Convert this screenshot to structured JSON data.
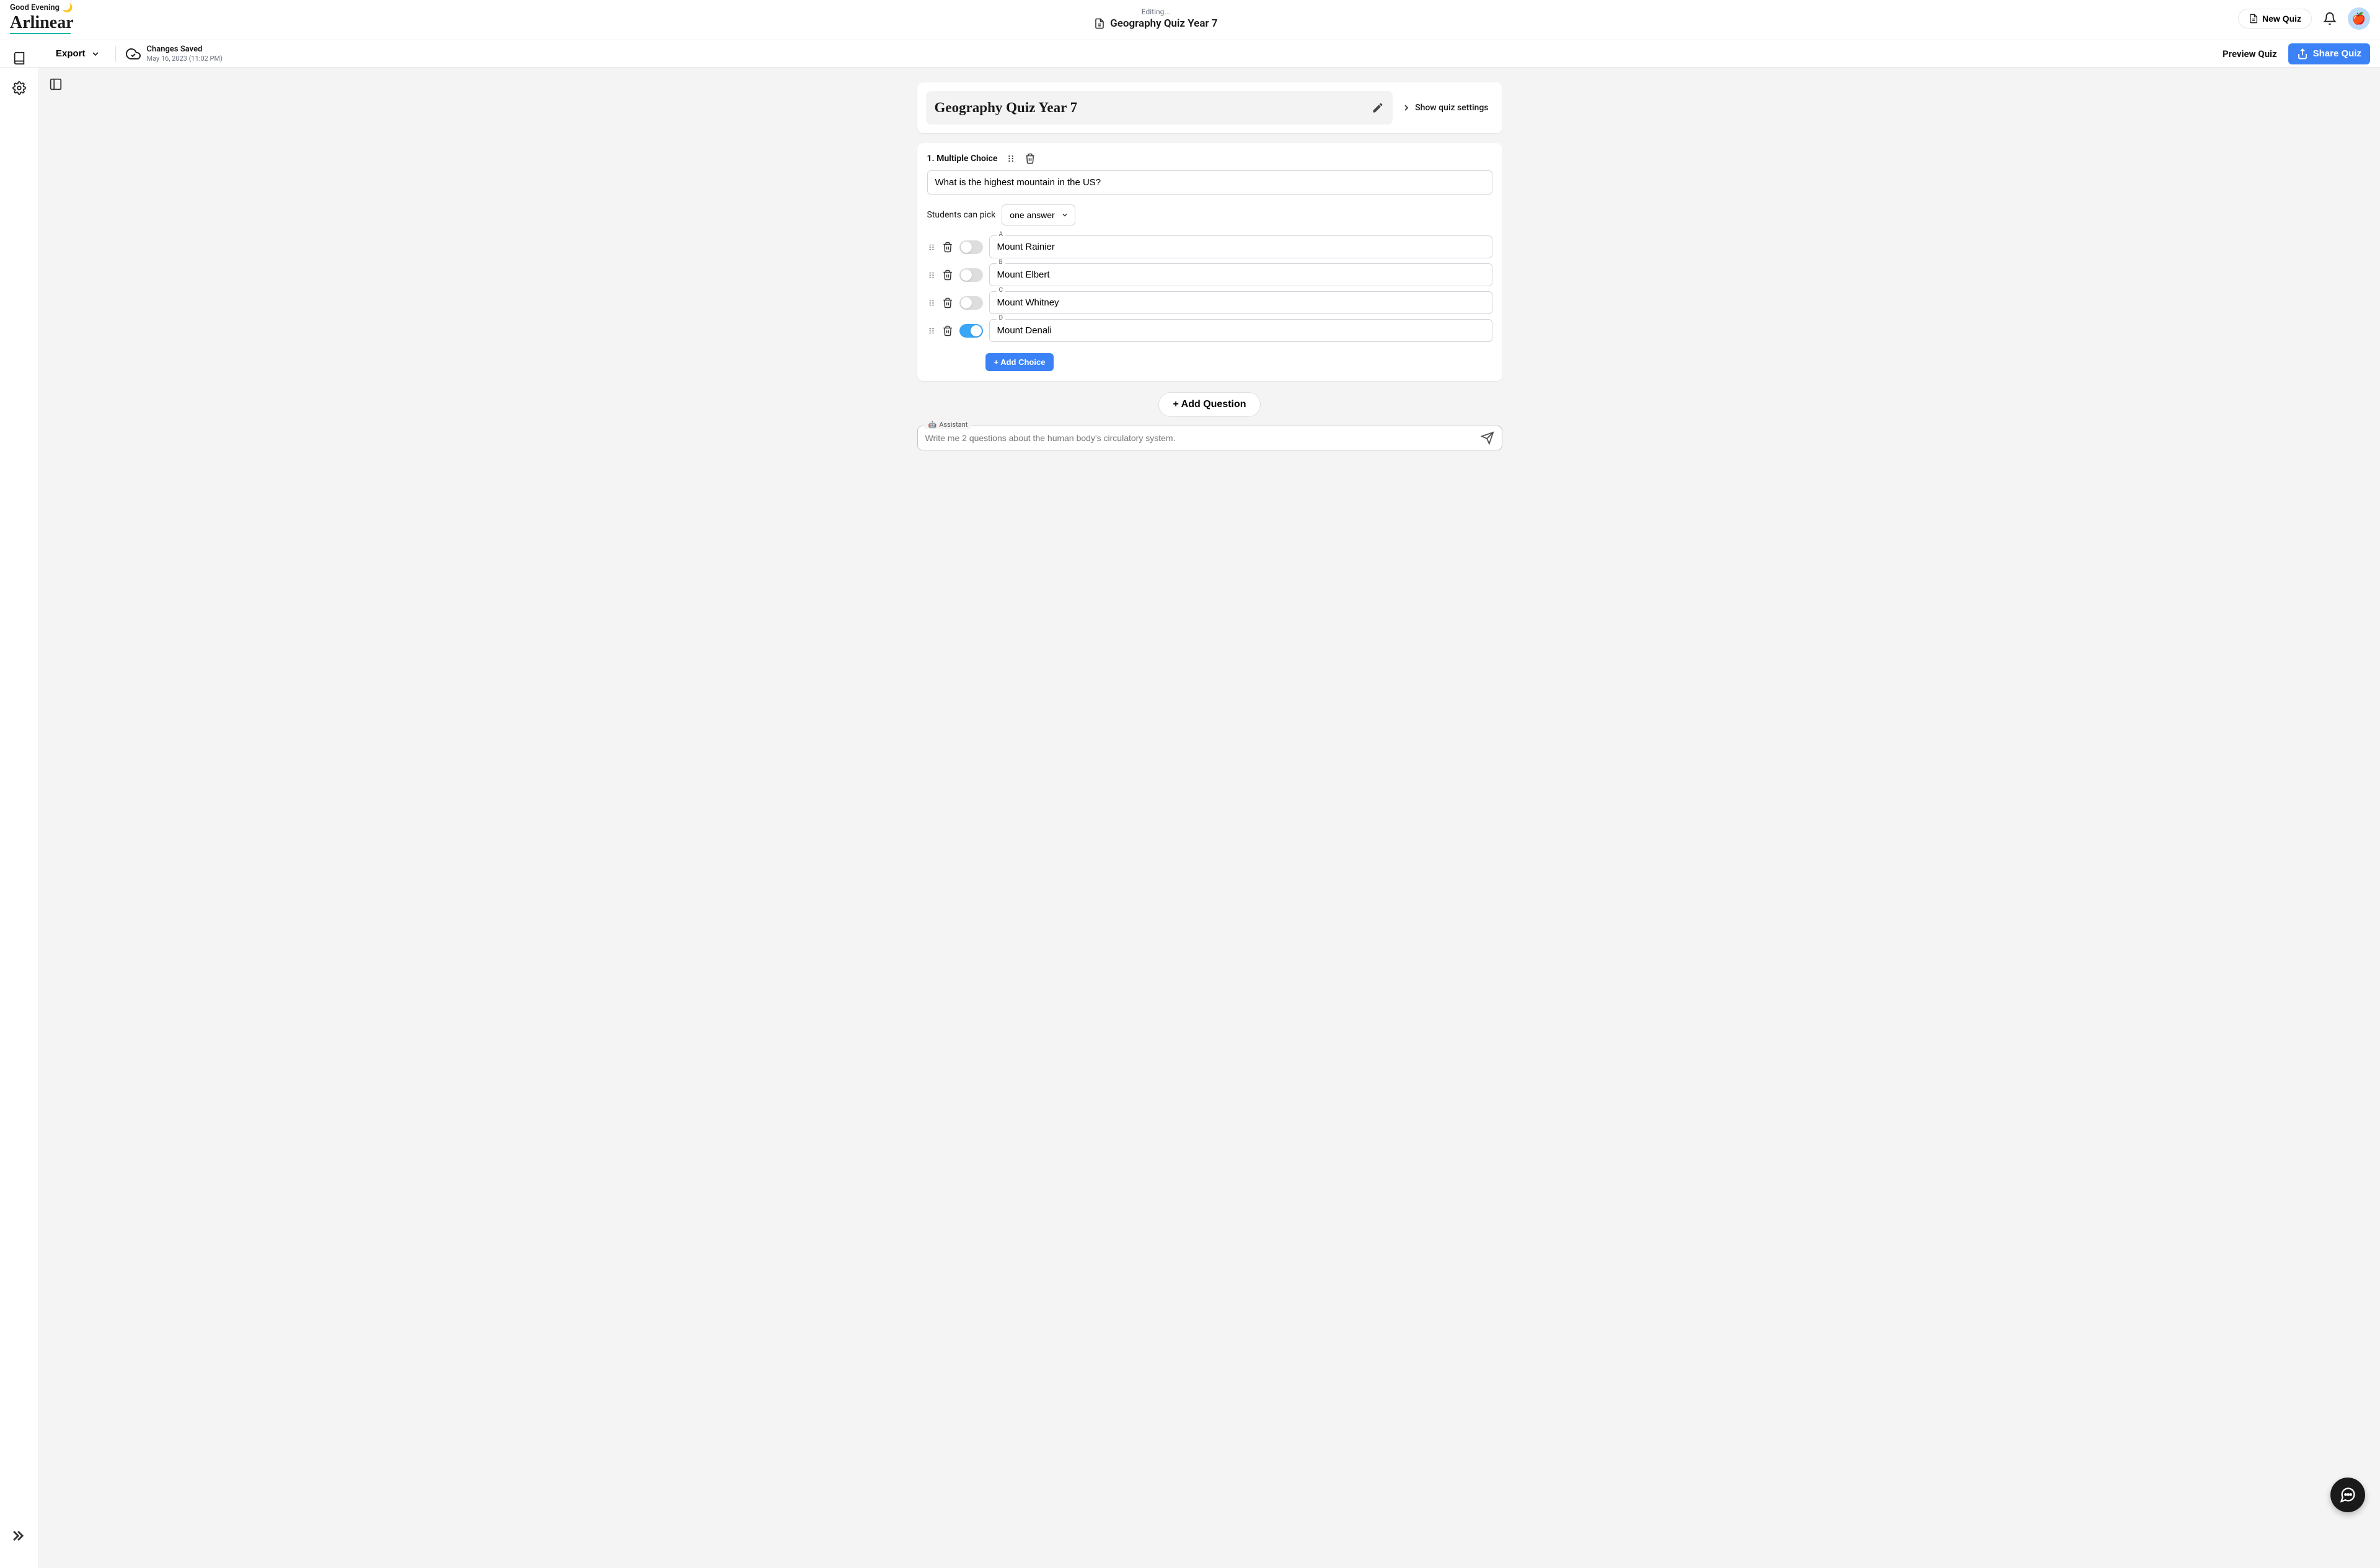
{
  "header": {
    "greeting": "Good Evening",
    "brand": "Arlinear",
    "editing_label": "Editing...",
    "doc_title": "Geography Quiz Year 7",
    "new_quiz": "New Quiz"
  },
  "toolbar": {
    "export": "Export",
    "save_status": "Changes Saved",
    "save_time": "May 16, 2023 (11:02 PM)",
    "preview": "Preview Quiz",
    "share": "Share Quiz"
  },
  "quiz": {
    "title": "Geography Quiz Year 7",
    "show_settings": "Show quiz settings"
  },
  "question": {
    "header": "1. Multiple Choice",
    "text": "What is the highest mountain in the US?",
    "pick_label": "Students can pick",
    "pick_value": "one answer",
    "choices": [
      {
        "letter": "A",
        "text": "Mount Rainier",
        "correct": false
      },
      {
        "letter": "B",
        "text": "Mount Elbert",
        "correct": false
      },
      {
        "letter": "C",
        "text": "Mount Whitney",
        "correct": false
      },
      {
        "letter": "D",
        "text": "Mount Denali",
        "correct": true
      }
    ],
    "add_choice": "+ Add Choice"
  },
  "add_question": "+ Add Question",
  "assistant": {
    "label": "Assistant",
    "placeholder": "Write me 2 questions about the human body's circulatory system."
  }
}
